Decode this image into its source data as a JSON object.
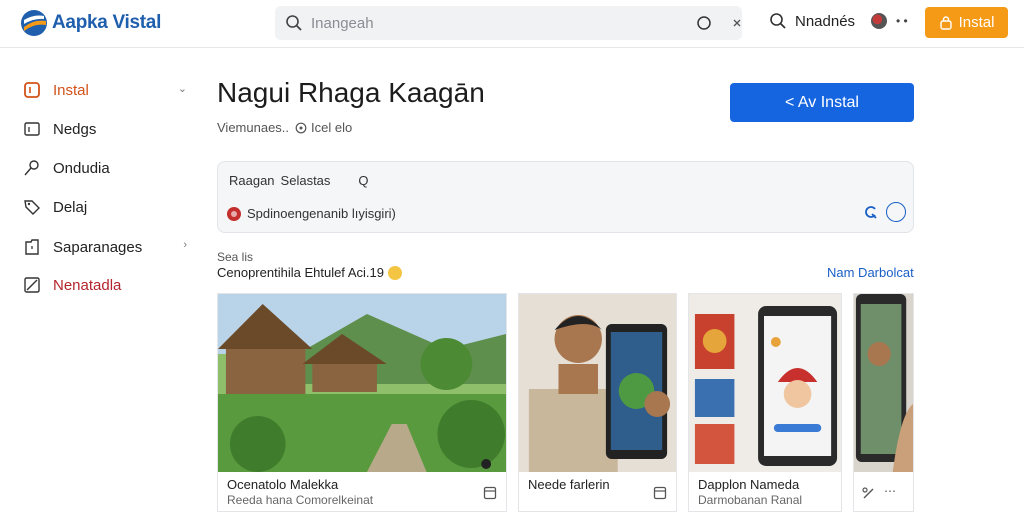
{
  "header": {
    "brand": "Aapka Vistal",
    "search_placeholder": "Inangeah",
    "nav_label": "Nnadnés",
    "user_caret": "• •",
    "install_label": "Instal"
  },
  "sidebar": {
    "items": [
      {
        "label": "Instal",
        "icon": "app-box-icon",
        "chevron": "⌄"
      },
      {
        "label": "Nedgs",
        "icon": "grid-icon"
      },
      {
        "label": "Ondudia",
        "icon": "pin-icon"
      },
      {
        "label": "Delaj",
        "icon": "tag-icon"
      },
      {
        "label": "Saparanages",
        "icon": "document-icon",
        "chevron": "›"
      },
      {
        "label": "Nenatadla",
        "icon": "edit-icon"
      }
    ]
  },
  "main": {
    "title": "Nagui Rhaga Kaagān",
    "meta_text": "Viemunaes..",
    "meta_rating": "Icel elo",
    "cta_label": "< Av Instal",
    "panel": {
      "row1_a": "Raagan",
      "row1_b": "Selastas",
      "row1_icon": "Q",
      "row2_text": "Spdinoengenanib lıyisgiri)"
    },
    "section_small": "Sea lis",
    "section_heading": "Cenoprentihila Ehtulef Aci.19",
    "see_more": "Nam Darbolcat"
  },
  "cards": [
    {
      "caption": "Ocenatolo Malekka",
      "subcaption": "Reeda hana Comorelkeinat"
    },
    {
      "caption": "Neede farlerin",
      "subcaption": ""
    },
    {
      "caption": "Dapplon Nameda",
      "subcaption": "Darmobanan Ranal"
    },
    {
      "caption": "",
      "subcaption": ""
    }
  ],
  "colors": {
    "brand_blue": "#1f5fae",
    "accent_orange": "#f59a16",
    "cta_blue": "#1565e0",
    "link_blue": "#1a5fc6",
    "active_orange": "#d2521a",
    "danger_red": "#b3262d"
  }
}
